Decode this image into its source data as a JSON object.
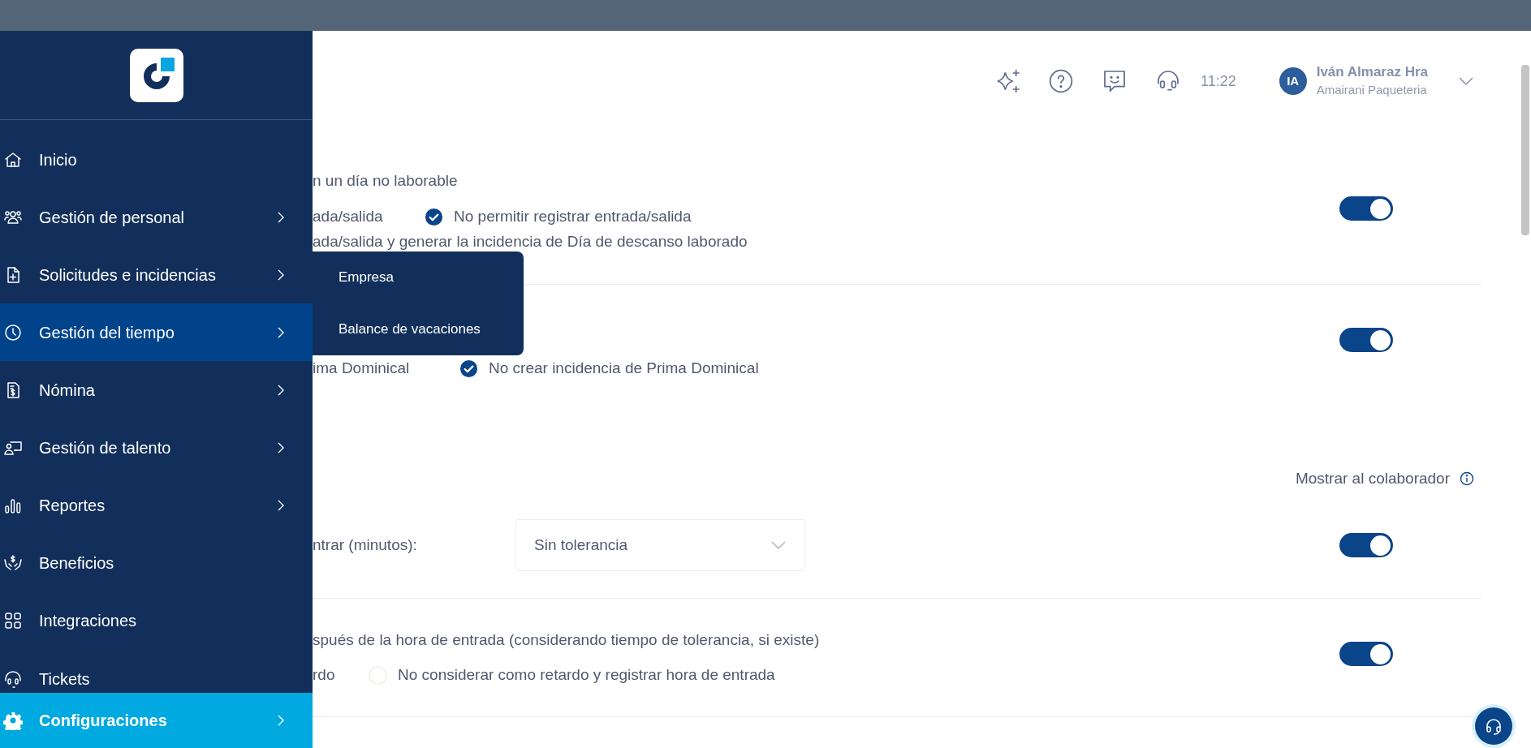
{
  "sidebar": {
    "items": [
      {
        "label": "Inicio",
        "expandable": false,
        "hovered": false,
        "selected": false
      },
      {
        "label": "Gestión de personal",
        "expandable": true,
        "hovered": false,
        "selected": false
      },
      {
        "label": "Solicitudes e incidencias",
        "expandable": true,
        "hovered": false,
        "selected": false
      },
      {
        "label": "Gestión del tiempo",
        "expandable": true,
        "hovered": true,
        "selected": false
      },
      {
        "label": "Nómina",
        "expandable": true,
        "hovered": false,
        "selected": false
      },
      {
        "label": "Gestión de talento",
        "expandable": true,
        "hovered": false,
        "selected": false
      },
      {
        "label": "Reportes",
        "expandable": true,
        "hovered": false,
        "selected": false
      },
      {
        "label": "Beneficios",
        "expandable": false,
        "hovered": false,
        "selected": false
      },
      {
        "label": "Integraciones",
        "expandable": false,
        "hovered": false,
        "selected": false
      },
      {
        "label": "Tickets",
        "expandable": false,
        "hovered": false,
        "selected": false
      },
      {
        "label": "Configuraciones",
        "expandable": true,
        "hovered": false,
        "selected": true
      }
    ]
  },
  "submenu": {
    "items": [
      {
        "label": "Empresa"
      },
      {
        "label": "Balance de vacaciones"
      }
    ]
  },
  "header": {
    "time": "11:22",
    "user": {
      "initials": "IA",
      "name": "Iván Almaraz Hra",
      "company": "Amairani Paqueteria"
    }
  },
  "sections": [
    {
      "kind": "choice",
      "lines": [
        {
          "kind": "text",
          "text": "n un día no laborable"
        },
        {
          "kind": "options",
          "options": [
            {
              "kind": "fragment",
              "label": "ada/salida"
            },
            {
              "kind": "radio",
              "label": "No permitir registrar entrada/salida",
              "selected": true
            }
          ]
        },
        {
          "kind": "text",
          "text": "ada/salida y generar la incidencia de Día de descanso laborado"
        }
      ],
      "toggle": {
        "on": true
      }
    },
    {
      "kind": "choice",
      "lines": [
        {
          "kind": "options",
          "options": [
            {
              "kind": "fragment",
              "label": "ima Dominical"
            },
            {
              "kind": "radio",
              "label": "No crear incidencia de Prima Dominical",
              "selected": true
            }
          ]
        }
      ],
      "toggle": {
        "on": true
      }
    },
    {
      "kind": "heading",
      "text": "Mostrar al colaborador"
    },
    {
      "kind": "select",
      "label": "ntrar (minutos):",
      "value": "Sin tolerancia",
      "toggle": {
        "on": true
      }
    },
    {
      "kind": "choice",
      "lines": [
        {
          "kind": "text",
          "text": "spués de la hora de entrada (considerando tiempo de tolerancia, si existe)"
        },
        {
          "kind": "options",
          "options": [
            {
              "kind": "fragment",
              "label": "rdo"
            },
            {
              "kind": "radio",
              "label": "No considerar como retardo y registrar hora de entrada",
              "selected": false
            }
          ]
        }
      ],
      "toggle": {
        "on": true
      }
    }
  ]
}
